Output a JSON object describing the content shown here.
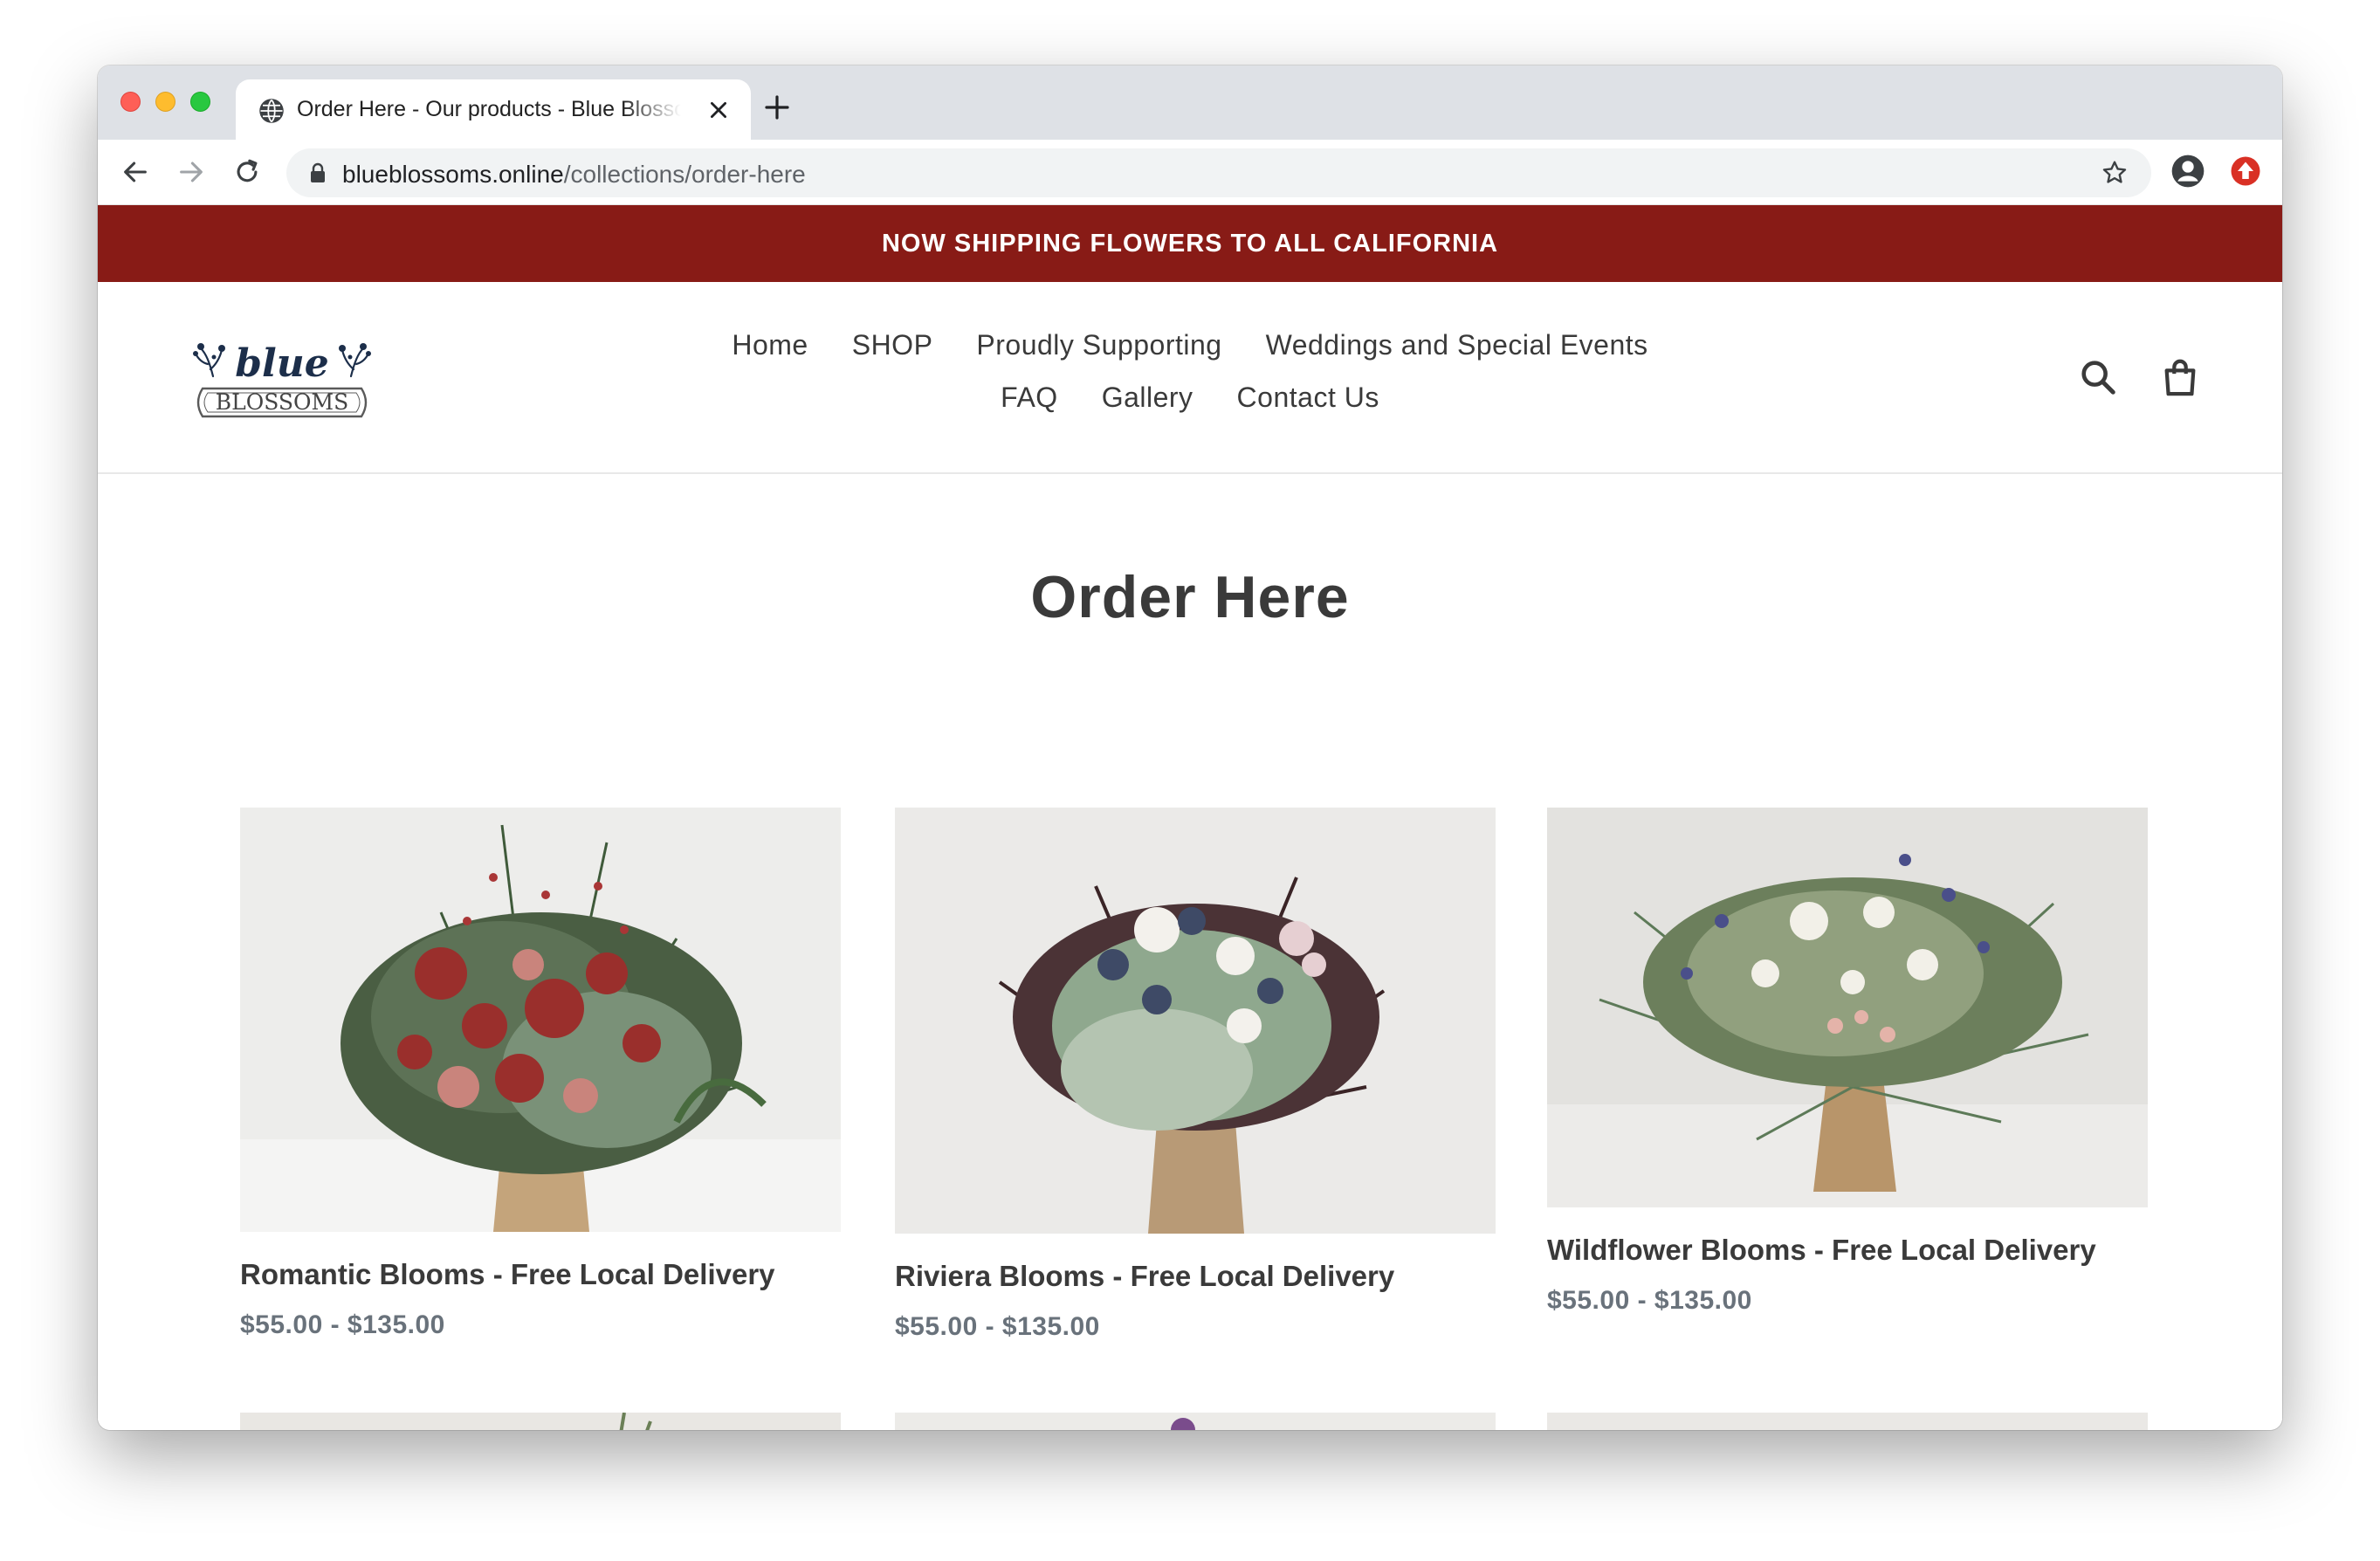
{
  "browser": {
    "tab_title": "Order Here - Our products - Blue Blossoms",
    "url_host": "blueblossoms.online",
    "url_path": "/collections/order-here"
  },
  "announcement": "NOW SHIPPING FLOWERS TO ALL CALIFORNIA",
  "logo": {
    "top_text": "blue",
    "bottom_text": "BLOSSOMS"
  },
  "nav": {
    "row1": [
      "Home",
      "SHOP",
      "Proudly Supporting",
      "Weddings and Special Events"
    ],
    "row2": [
      "FAQ",
      "Gallery",
      "Contact Us"
    ]
  },
  "page_title": "Order Here",
  "products": [
    {
      "title": "Romantic Blooms - Free Local Delivery",
      "price": "$55.00 - $135.00"
    },
    {
      "title": "Riviera Blooms - Free Local Delivery",
      "price": "$55.00 - $135.00"
    },
    {
      "title": "Wildflower Blooms - Free Local Delivery",
      "price": "$55.00 - $135.00"
    }
  ],
  "colors": {
    "announcement_bg": "#881b16",
    "text": "#3a3a3a",
    "price": "#69727b"
  }
}
